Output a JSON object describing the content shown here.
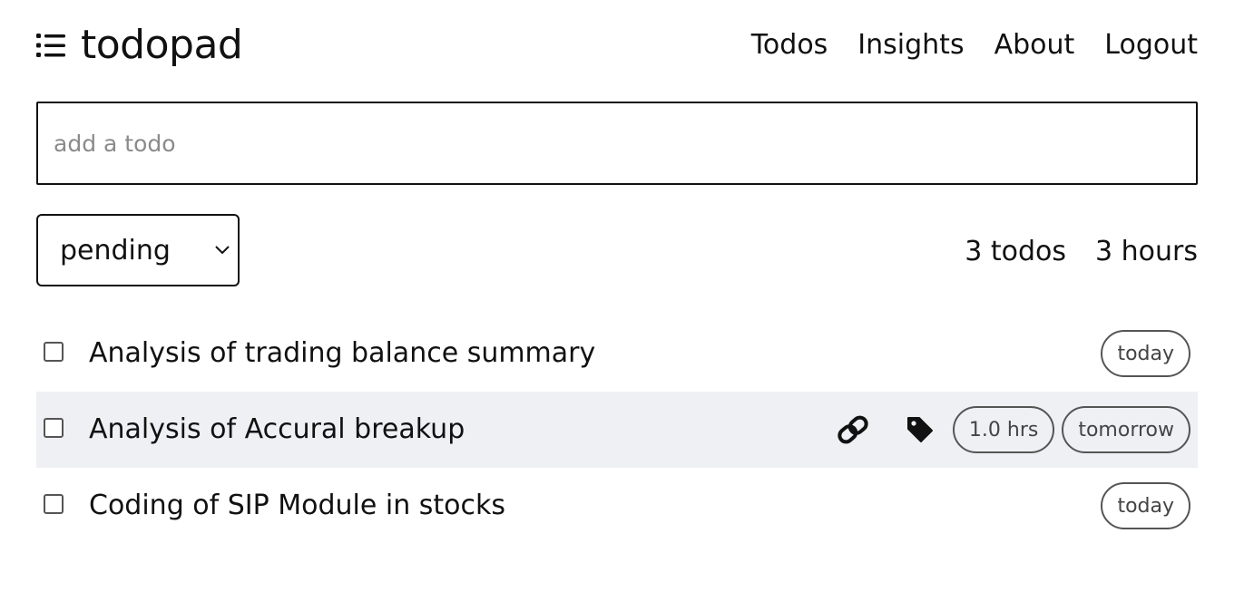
{
  "header": {
    "brand": "todopad",
    "nav": [
      "Todos",
      "Insights",
      "About",
      "Logout"
    ]
  },
  "add_todo": {
    "placeholder": "add a todo",
    "value": ""
  },
  "filter": {
    "selected": "pending"
  },
  "stats": {
    "todos": "3 todos",
    "hours": "3 hours"
  },
  "todos": [
    {
      "title": "Analysis of trading balance summary",
      "due": "today"
    },
    {
      "title": "Analysis of Accural breakup",
      "duration": "1.0 hrs",
      "due": "tomorrow"
    },
    {
      "title": "Coding of SIP Module in stocks",
      "due": "today"
    }
  ],
  "icons": [
    "list-icon",
    "chevron-down-icon",
    "link-icon",
    "tag-icon"
  ],
  "colors": {
    "row_highlight": "#eff0f4",
    "text": "#111111",
    "pill_border": "#555555"
  }
}
